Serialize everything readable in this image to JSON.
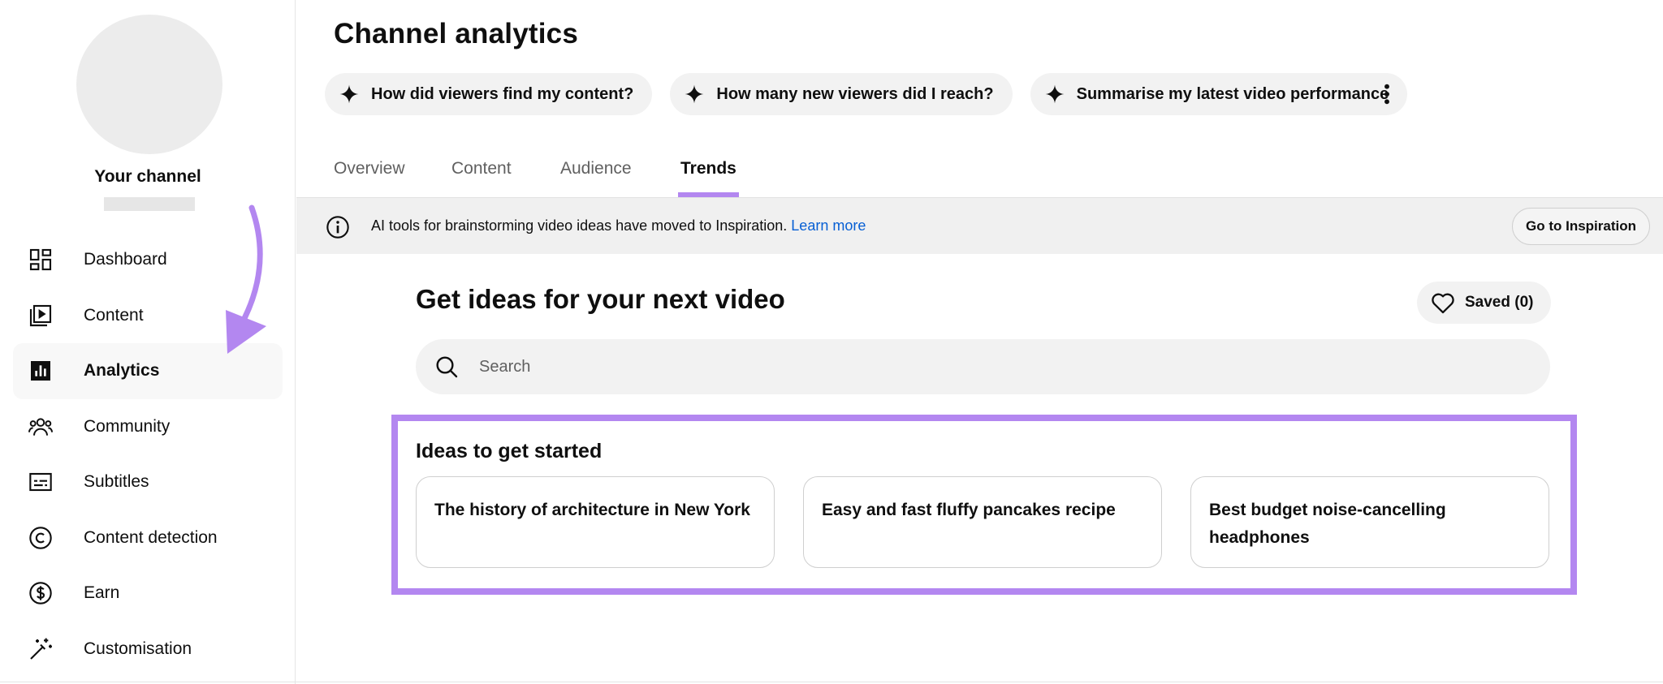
{
  "sidebar": {
    "channel_name": "Your channel",
    "items": [
      {
        "label": "Dashboard",
        "icon": "dashboard-icon"
      },
      {
        "label": "Content",
        "icon": "content-icon"
      },
      {
        "label": "Analytics",
        "icon": "analytics-icon",
        "active": true
      },
      {
        "label": "Community",
        "icon": "community-icon"
      },
      {
        "label": "Subtitles",
        "icon": "subtitles-icon"
      },
      {
        "label": "Content detection",
        "icon": "copyright-icon"
      },
      {
        "label": "Earn",
        "icon": "dollar-icon"
      },
      {
        "label": "Customisation",
        "icon": "magic-wand-icon"
      }
    ]
  },
  "header": {
    "title": "Channel analytics",
    "chips": [
      {
        "label": "How did viewers find my content?",
        "icon": "sparkle-icon"
      },
      {
        "label": "How many new viewers did I reach?",
        "icon": "sparkle-icon"
      },
      {
        "label": "Summarise my latest video performance",
        "icon": "sparkle-icon"
      }
    ],
    "more_icon": "more-vert-icon"
  },
  "tabs": [
    {
      "label": "Overview"
    },
    {
      "label": "Content"
    },
    {
      "label": "Audience"
    },
    {
      "label": "Trends",
      "active": true
    }
  ],
  "banner": {
    "text": "AI tools for brainstorming video ideas have moved to Inspiration.",
    "link": "Learn more",
    "button": "Go to Inspiration",
    "icon": "info-icon"
  },
  "ideas": {
    "title": "Get ideas for your next video",
    "saved_label": "Saved (0)",
    "search_placeholder": "Search",
    "started_title": "Ideas to get started",
    "cards": [
      {
        "text": "The history of architecture in New York"
      },
      {
        "text": "Easy and fast fluffy pancakes recipe"
      },
      {
        "text": "Best budget noise-cancelling headphones"
      }
    ]
  },
  "colors": {
    "accent_purple": "#b387f0",
    "link_blue": "#065fd4",
    "chip_bg": "#f2f2f2"
  }
}
